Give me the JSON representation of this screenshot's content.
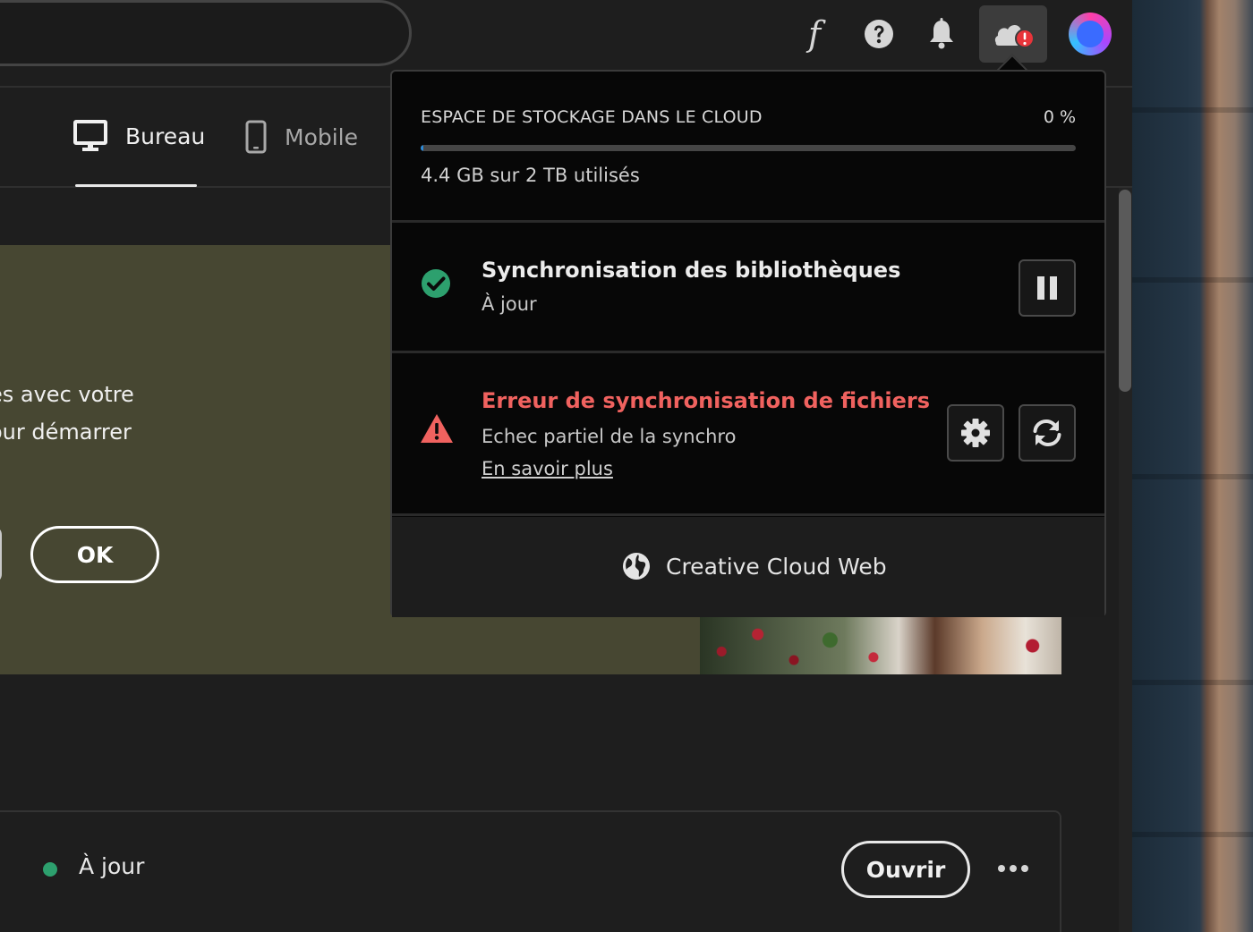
{
  "nav": {
    "tabs": [
      {
        "label": "Bureau",
        "icon": "desktop-icon",
        "active": true
      },
      {
        "label": "Mobile",
        "icon": "mobile-icon",
        "active": false
      }
    ]
  },
  "topbar": {
    "icons": [
      "font-icon",
      "help-icon",
      "bell-icon",
      "cloud-error-icon",
      "avatar"
    ],
    "font_glyph": "f"
  },
  "banner": {
    "text_line1": "es avec votre",
    "text_line2": "our démarrer",
    "ok_label": "OK"
  },
  "popover": {
    "storage": {
      "title": "ESPACE DE STOCKAGE DANS LE CLOUD",
      "percent_label": "0 %",
      "used_fraction": 0.002,
      "used_text": "4.4 GB sur 2 TB utilisés"
    },
    "library_sync": {
      "title": "Synchronisation des bibliothèques",
      "status": "À jour",
      "status_color": "#2da06e",
      "action_icon": "pause-icon"
    },
    "file_sync_error": {
      "title": "Erreur de synchronisation de fichiers",
      "detail": "Echec partiel de la synchro",
      "link": "En savoir plus",
      "error_color": "#f0625f",
      "actions": [
        "gear-icon",
        "refresh-icon"
      ]
    },
    "web": {
      "label": "Creative Cloud Web",
      "icon": "globe-icon"
    }
  },
  "card": {
    "status": "À jour",
    "open_label": "Ouvrir",
    "more_icon": "more-icon"
  },
  "colors": {
    "accent_blue": "#2c8ad8",
    "success_green": "#2da06e",
    "error_red": "#f0625f",
    "banner_bg": "#474732"
  }
}
